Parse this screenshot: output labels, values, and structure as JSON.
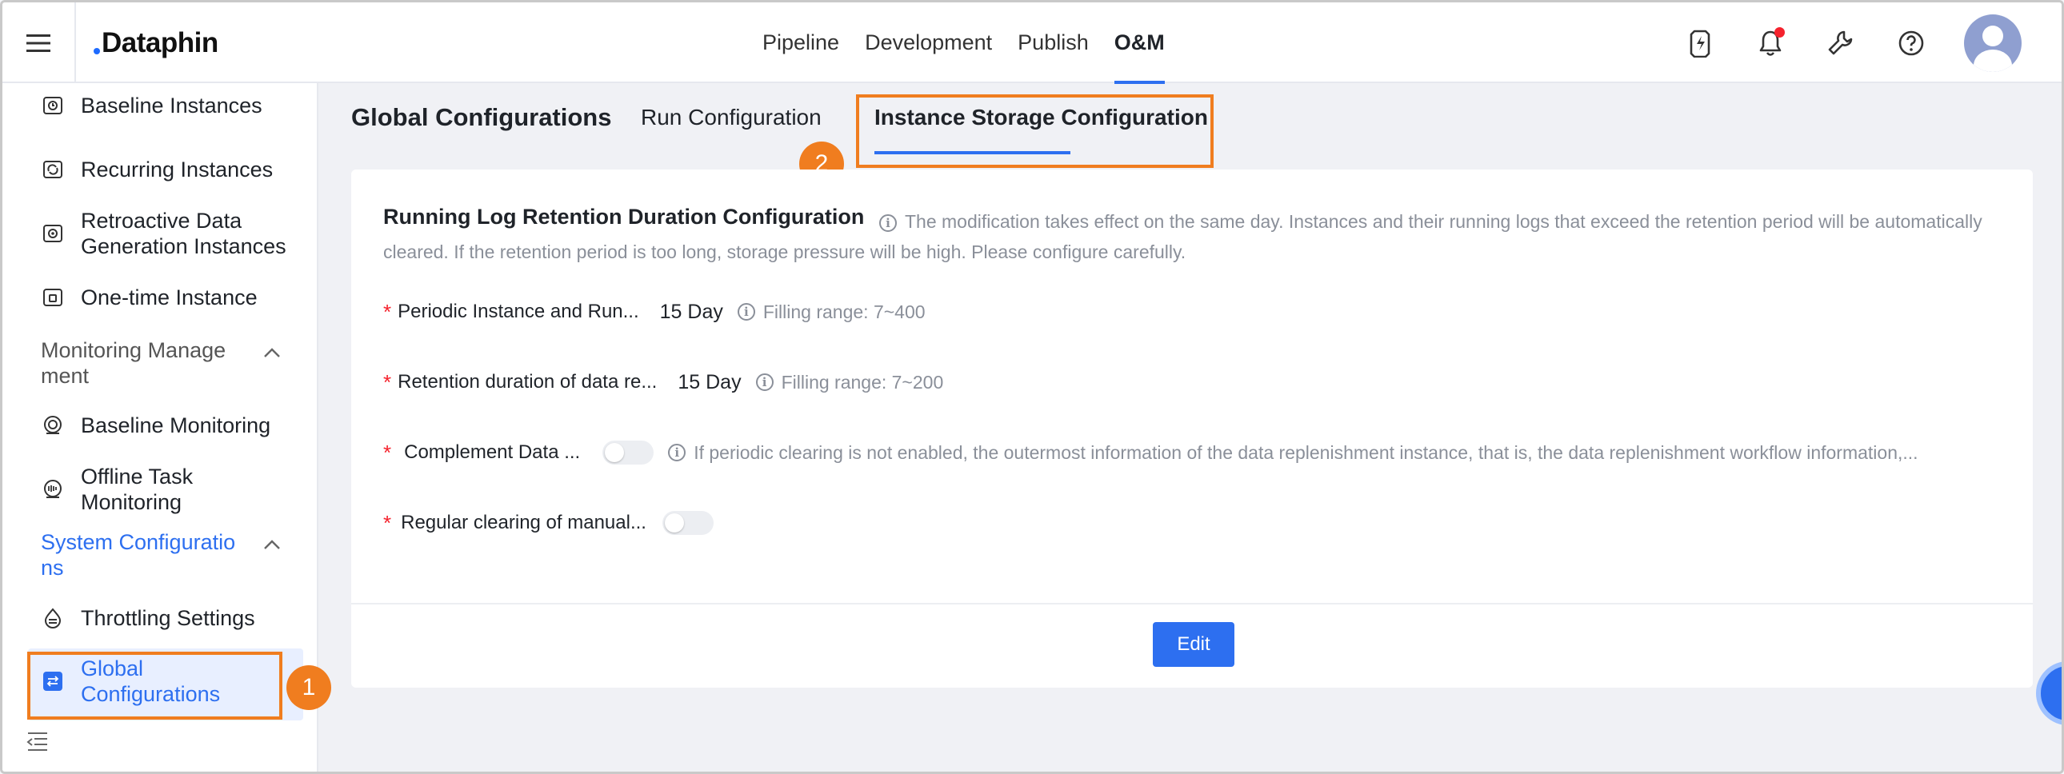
{
  "topbar": {
    "logo": "Dataphin",
    "nav": [
      "Pipeline",
      "Development",
      "Publish",
      "O&M"
    ],
    "active_nav": "O&M",
    "icons": [
      "lightning-icon",
      "bell-icon",
      "wrench-icon",
      "help-icon",
      "avatar"
    ]
  },
  "sidebar": {
    "items": {
      "baseline_instances": "Baseline Instances",
      "recurring_instances": "Recurring Instances",
      "retroactive_1": "Retroactive Data",
      "retroactive_2": "Generation Instances",
      "one_time": "One-time Instance",
      "monitoring_group_1": "Monitoring Manage",
      "monitoring_group_2": "ment",
      "baseline_monitoring": "Baseline Monitoring",
      "offline_1": "Offline Task",
      "offline_2": "Monitoring",
      "system_group_1": "System Configuratio",
      "system_group_2": "ns",
      "throttling": "Throttling Settings",
      "global_1": "Global",
      "global_2": "Configurations"
    },
    "badge": "1"
  },
  "main": {
    "title": "Global Configurations",
    "tabs": [
      "Run Configuration",
      "Instance Storage Configuration"
    ],
    "active_tab": "Instance Storage Configuration",
    "badge": "2",
    "section_title": "Running Log Retention Duration Configuration",
    "section_desc": "The modification takes effect on the same day. Instances and their running logs that exceed the retention period will be automatically cleared. If the retention period is too long, storage pressure will be high. Please configure carefully.",
    "fields": [
      {
        "label": "Periodic Instance and Run...",
        "value": "15",
        "unit": "Day",
        "hint": "Filling range: 7~400"
      },
      {
        "label": "Retention duration of data re...",
        "value": "15",
        "unit": "Day",
        "hint": "Filling range: 7~200"
      },
      {
        "label": "Complement Data ...",
        "hint": "If periodic clearing is not enabled, the outermost information of the data replenishment instance, that is, the data replenishment workflow information,..."
      },
      {
        "label": "Regular clearing of manual..."
      }
    ],
    "required_mark": "*",
    "edit_label": "Edit"
  }
}
